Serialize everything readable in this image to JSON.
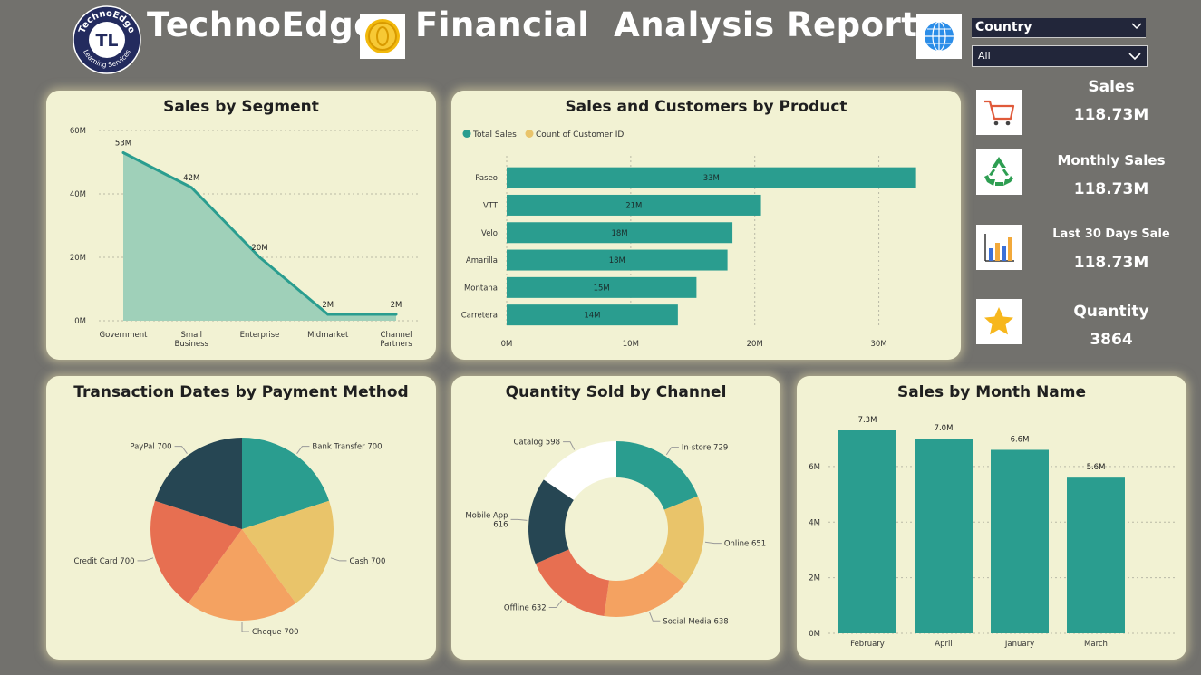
{
  "header": {
    "brand": "TechnoEdge",
    "report_title": "Financial  Analysis Report",
    "logo_top_text": "TechnoEdge",
    "logo_monogram": "TL",
    "logo_bottom_text": "Learning Services"
  },
  "filter": {
    "label": "Country",
    "selected": "All"
  },
  "kpis": [
    {
      "label": "Sales",
      "value": "118.73M",
      "icon": "shopping-cart-icon"
    },
    {
      "label": "Monthly Sales",
      "value": "118.73M",
      "icon": "recycle-icon"
    },
    {
      "label": "Last 30 Days Sale",
      "value": "118.73M",
      "icon": "bar-chart-icon"
    },
    {
      "label": "Quantity",
      "value": "3864",
      "icon": "star-icon"
    }
  ],
  "colors": {
    "teal": "#2a9d8f",
    "teal_fill": "#9fd0b9",
    "dark": "#264653",
    "yellow": "#e9c46a",
    "orange": "#f4a261",
    "red": "#e76f51",
    "white": "#ffffff",
    "card_bg": "#f2f2d3"
  },
  "chart_data": [
    {
      "id": "segment",
      "type": "area",
      "title": "Sales by Segment",
      "categories": [
        "Government",
        "Small Business",
        "Enterprise",
        "Midmarket",
        "Channel Partners"
      ],
      "category_lines": [
        [
          "Government"
        ],
        [
          "Small",
          "Business"
        ],
        [
          "Enterprise"
        ],
        [
          "Midmarket"
        ],
        [
          "Channel",
          "Partners"
        ]
      ],
      "values": [
        53,
        42,
        20,
        2,
        2
      ],
      "data_labels": [
        "53M",
        "42M",
        "20M",
        "2M",
        "2M"
      ],
      "yticks": [
        0,
        20,
        40,
        60
      ],
      "ytick_labels": [
        "0M",
        "20M",
        "40M",
        "60M"
      ],
      "ylim": [
        0,
        60
      ],
      "grid": true
    },
    {
      "id": "product",
      "type": "bar",
      "orientation": "horizontal",
      "title": "Sales and Customers by Product",
      "legend": [
        "Total Sales",
        "Count of Customer ID"
      ],
      "legend_position": "top-left",
      "categories": [
        "Paseo",
        "VTT",
        "Velo",
        "Amarilla",
        "Montana",
        "Carretera"
      ],
      "values": [
        33,
        21,
        18,
        18,
        15,
        14
      ],
      "value_positions": [
        33.0,
        20.5,
        18.2,
        17.8,
        15.3,
        13.8
      ],
      "data_labels": [
        "33M",
        "21M",
        "18M",
        "18M",
        "15M",
        "14M"
      ],
      "xticks": [
        0,
        10,
        20,
        30
      ],
      "xtick_labels": [
        "0M",
        "10M",
        "20M",
        "30M"
      ],
      "xlim": [
        0,
        35
      ],
      "grid": true
    },
    {
      "id": "payment",
      "type": "pie",
      "title": "Transaction Dates by Payment Method",
      "labels": [
        "Bank Transfer 700",
        "Cash 700",
        "Cheque 700",
        "Credit Card 700",
        "PayPal 700"
      ],
      "values": [
        700,
        700,
        700,
        700,
        700
      ],
      "slice_colors": [
        "#2a9d8f",
        "#e9c46a",
        "#f4a261",
        "#e76f51",
        "#264653"
      ]
    },
    {
      "id": "channel",
      "type": "pie",
      "donut": true,
      "title": "Quantity Sold by Channel",
      "labels": [
        "In-store 729",
        "Online 651",
        "Social Media 638",
        "Offline 632",
        "Mobile App 616",
        "Catalog 598"
      ],
      "label_lines": [
        [
          "In-store 729"
        ],
        [
          "Online 651"
        ],
        [
          "Social Media 638"
        ],
        [
          "Offline 632"
        ],
        [
          "Mobile App",
          "616"
        ],
        [
          "Catalog 598"
        ]
      ],
      "values": [
        729,
        651,
        638,
        632,
        616,
        598
      ],
      "slice_colors": [
        "#2a9d8f",
        "#e9c46a",
        "#f4a261",
        "#e76f51",
        "#264653",
        "#ffffff"
      ]
    },
    {
      "id": "month",
      "type": "bar",
      "title": "Sales by Month Name",
      "categories": [
        "February",
        "April",
        "January",
        "March"
      ],
      "values": [
        7.3,
        7.0,
        6.6,
        5.6
      ],
      "data_labels": [
        "7.3M",
        "7.0M",
        "6.6M",
        "5.6M"
      ],
      "yticks": [
        0,
        2,
        4,
        6
      ],
      "ytick_labels": [
        "0M",
        "2M",
        "4M",
        "6M"
      ],
      "ylim": [
        0,
        7.3
      ],
      "grid": true
    }
  ]
}
